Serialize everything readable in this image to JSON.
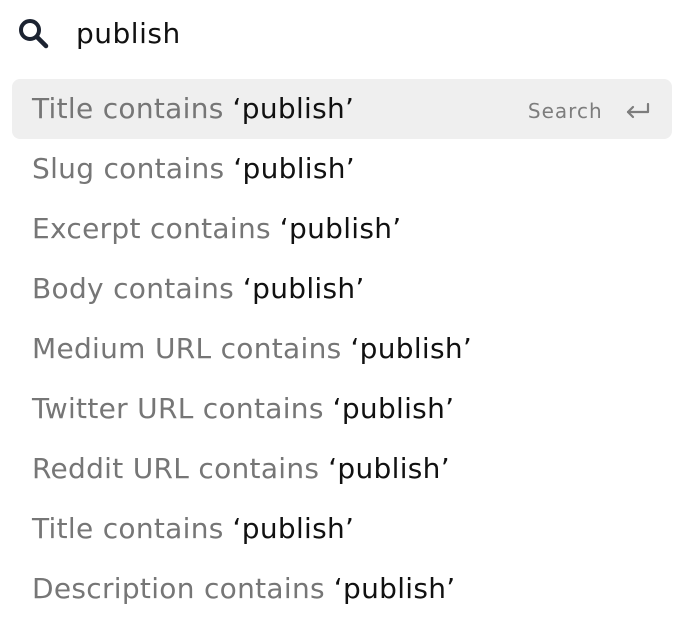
{
  "search": {
    "query": "publish",
    "icon": "search-icon"
  },
  "suggestions": [
    {
      "field_text": "Title contains",
      "term_text": "‘publish’",
      "active": true
    },
    {
      "field_text": "Slug contains",
      "term_text": "‘publish’"
    },
    {
      "field_text": "Excerpt contains",
      "term_text": "‘publish’"
    },
    {
      "field_text": "Body contains",
      "term_text": "‘publish’"
    },
    {
      "field_text": "Medium URL contains",
      "term_text": "‘publish’"
    },
    {
      "field_text": "Twitter URL contains",
      "term_text": "‘publish’"
    },
    {
      "field_text": "Reddit URL contains",
      "term_text": "‘publish’"
    },
    {
      "field_text": "Title contains",
      "term_text": "‘publish’"
    },
    {
      "field_text": "Description contains",
      "term_text": "‘publish’"
    }
  ],
  "active_hint": {
    "label": "Search",
    "icon": "enter-key-icon"
  },
  "colors": {
    "active_background": "#efefef",
    "field_text": "#767676",
    "term_text": "#111111",
    "hint_text": "#7d7d7d",
    "icon": "#1c2331"
  }
}
